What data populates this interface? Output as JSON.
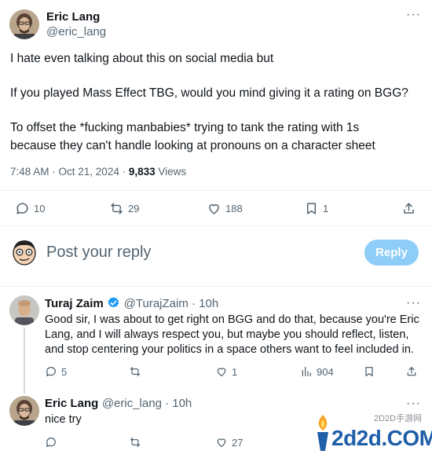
{
  "post": {
    "author_name": "Eric Lang",
    "author_handle": "@eric_lang",
    "more_icon": "more-horizontal-icon",
    "lines": [
      "I hate even talking about this on social media but",
      "If you played Mass Effect TBG, would you mind giving it a rating on BGG?",
      "To offset the *fucking manbabies* trying to tank the rating with 1s",
      "because they can't handle looking at pronouns on a character sheet"
    ],
    "timestamp": "7:48 AM · Oct 21, 2024 · ",
    "views_count": "9,833",
    "views_label": " Views",
    "actions": {
      "replies": "10",
      "reposts": "29",
      "likes": "188",
      "bookmarks": "1"
    }
  },
  "composer": {
    "placeholder": "Post your reply",
    "reply_button": "Reply",
    "reply_button_color": "#8ecdf7"
  },
  "replies": [
    {
      "author_name": "Turaj Zaim",
      "verified": true,
      "verified_color": "#1d9bf0",
      "author_handle": "@TurajZaim · 10h",
      "lines": [
        "Good sir, I was about to get right on BGG and do that, because you're Eric",
        "Lang, and I will always respect you, but maybe you should reflect, listen,",
        "and stop centering your politics in a space others want to feel included in."
      ],
      "actions": {
        "replies": "5",
        "reposts": "",
        "likes": "1",
        "views": "904"
      }
    },
    {
      "author_name": "Eric Lang",
      "author_handle": "@eric_lang · 10h",
      "lines": [
        "nice try"
      ],
      "actions": {
        "replies": "",
        "reposts": "",
        "likes": "27"
      }
    }
  ],
  "watermark": {
    "text": "2d2d.COM",
    "subtext": "2D2D手游网"
  }
}
